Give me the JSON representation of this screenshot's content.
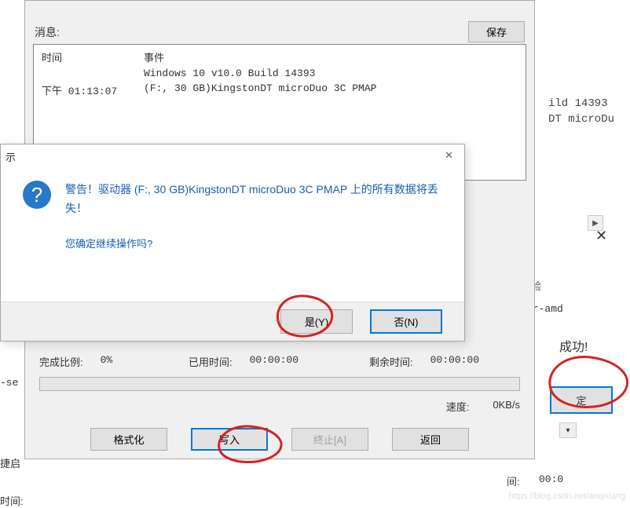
{
  "msg": {
    "label": "消息:",
    "save_btn": "保存",
    "header_time": "时间",
    "header_event": "事件",
    "row1_event": "Windows 10 v10.0 Build 14393",
    "row2_time": "下午 01:13:07",
    "row2_event": "(F:, 30 GB)KingstonDT microDuo 3C  PMAP"
  },
  "dialog": {
    "title": "示",
    "warning_line": "警告！驱动器 (F:, 30 GB)KingstonDT microDuo 3C  PMAP 上的所有数据将丢失！",
    "question": "您确定继续操作吗?",
    "yes_label": "是(Y)",
    "no_label": "否(N)"
  },
  "progress": {
    "pct_label": "完成比例:",
    "pct_value": "0%",
    "elapsed_label": "已用时间:",
    "elapsed_value": "00:00:00",
    "remain_label": "剩余时间:",
    "remain_value": "00:00:00",
    "speed_label": "速度:",
    "speed_value": "0KB/s",
    "btn_format": "格式化",
    "btn_write": "写入",
    "btn_stop": "终止[A]",
    "btn_back": "返回"
  },
  "bg": {
    "text1": "ild 14393",
    "text2": "DT microDu",
    "field_label": "验",
    "input_text": "er-amd",
    "success": "成功!",
    "ok_btn": "定",
    "bottom_label": "间:",
    "bottom_time": "00:0"
  },
  "frags": {
    "left1": "-se",
    "left2": "捷启",
    "bottom_time": "时间:"
  },
  "watermark": "https://blog.csdn.net/anqixiang"
}
